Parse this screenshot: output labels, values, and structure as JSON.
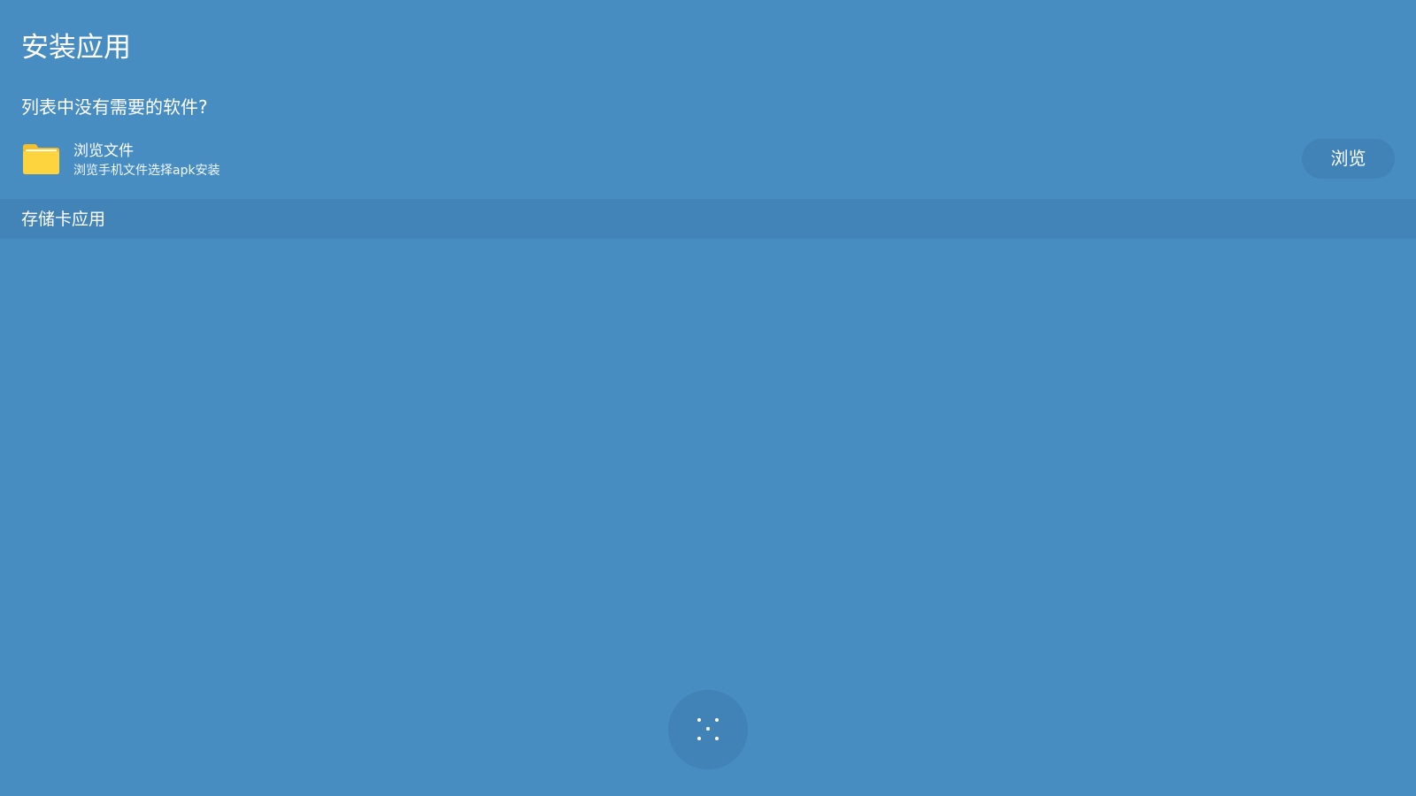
{
  "page": {
    "title": "安装应用",
    "background_color": "#478dc2"
  },
  "browse": {
    "prompt": "列表中没有需要的软件?",
    "icon": "folder-icon",
    "title": "浏览文件",
    "subtitle": "浏览手机文件选择apk安装",
    "button_label": "浏览",
    "icon_color": "#fdd43d"
  },
  "storage_section": {
    "title": "存储卡应用",
    "background_color": "#4283b8"
  },
  "loading": {
    "icon": "loading-spinner-icon"
  }
}
